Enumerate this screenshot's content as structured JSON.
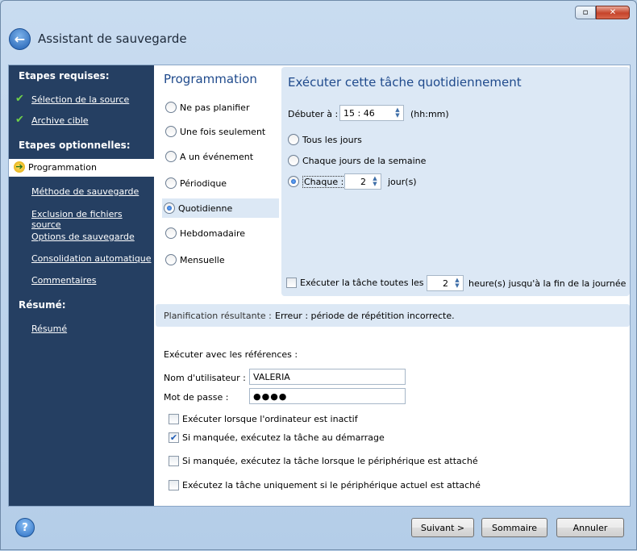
{
  "window": {
    "title": "Assistant de sauvegarde",
    "restore_glyph": "▫",
    "close_glyph": "✕",
    "back_glyph": "←"
  },
  "sidebar": {
    "required_heading": "Etapes requises:",
    "required_items": [
      {
        "label": "Sélection de la source",
        "done": true
      },
      {
        "label": "Archive cible",
        "done": true
      }
    ],
    "optional_heading": "Etapes optionnelles:",
    "active_item": "Programmation",
    "optional_items": [
      {
        "label": "Méthode de sauvegarde"
      },
      {
        "label": "Exclusion de fichiers source"
      },
      {
        "label": "Options de sauvegarde"
      },
      {
        "label": "Consolidation automatique"
      },
      {
        "label": "Commentaires"
      }
    ],
    "summary_heading": "Résumé:",
    "summary_item": "Résumé",
    "check_glyph": "✔",
    "arrow_glyph": "➔"
  },
  "schedule": {
    "title": "Programmation",
    "options": [
      {
        "label": "Ne pas planifier",
        "selected": false
      },
      {
        "label": "Une fois seulement",
        "selected": false
      },
      {
        "label": "A un événement",
        "selected": false
      },
      {
        "label": "Périodique",
        "selected": false
      },
      {
        "label": "Quotidienne",
        "selected": true
      },
      {
        "label": "Hebdomadaire",
        "selected": false
      },
      {
        "label": "Mensuelle",
        "selected": false
      }
    ]
  },
  "daily": {
    "title": "Exécuter cette tâche quotidiennement",
    "start_label": "Débuter à :",
    "start_value": "15 : 46",
    "start_unit": "(hh:mm)",
    "every_day": "Tous les jours",
    "weekdays": "Chaque jours de la semaine",
    "every_label": "Chaque :",
    "every_value": "2",
    "every_unit": "jour(s)",
    "repeat_label": "Exécuter la tâche toutes les :",
    "repeat_value": "2",
    "repeat_unit": "heure(s) jusqu'à la fin de la journée",
    "repeat_checked": false
  },
  "result": {
    "label": "Planification résultante :",
    "value": "Erreur : période de répétition incorrecte."
  },
  "credentials": {
    "heading": "Exécuter avec les références :",
    "user_label": "Nom d'utilisateur :",
    "user_value": "VALERIA",
    "password_label": "Mot de passe :",
    "password_value": "●●●●"
  },
  "conditions": [
    {
      "label": "Exécuter lorsque l'ordinateur est inactif",
      "checked": false
    },
    {
      "label": "Si manquée, exécutez la tâche au démarrage",
      "checked": true
    },
    {
      "label": "Si manquée, exécutez la tâche lorsque le périphérique est attaché",
      "checked": false
    },
    {
      "label": "Exécutez la tâche uniquement si le périphérique actuel est attaché",
      "checked": false
    }
  ],
  "buttons": {
    "help": "?",
    "next": "Suivant >",
    "summary": "Sommaire",
    "cancel": "Annuler"
  },
  "glyphs": {
    "spin_up": "▲",
    "spin_down": "▼",
    "check": "✔"
  }
}
